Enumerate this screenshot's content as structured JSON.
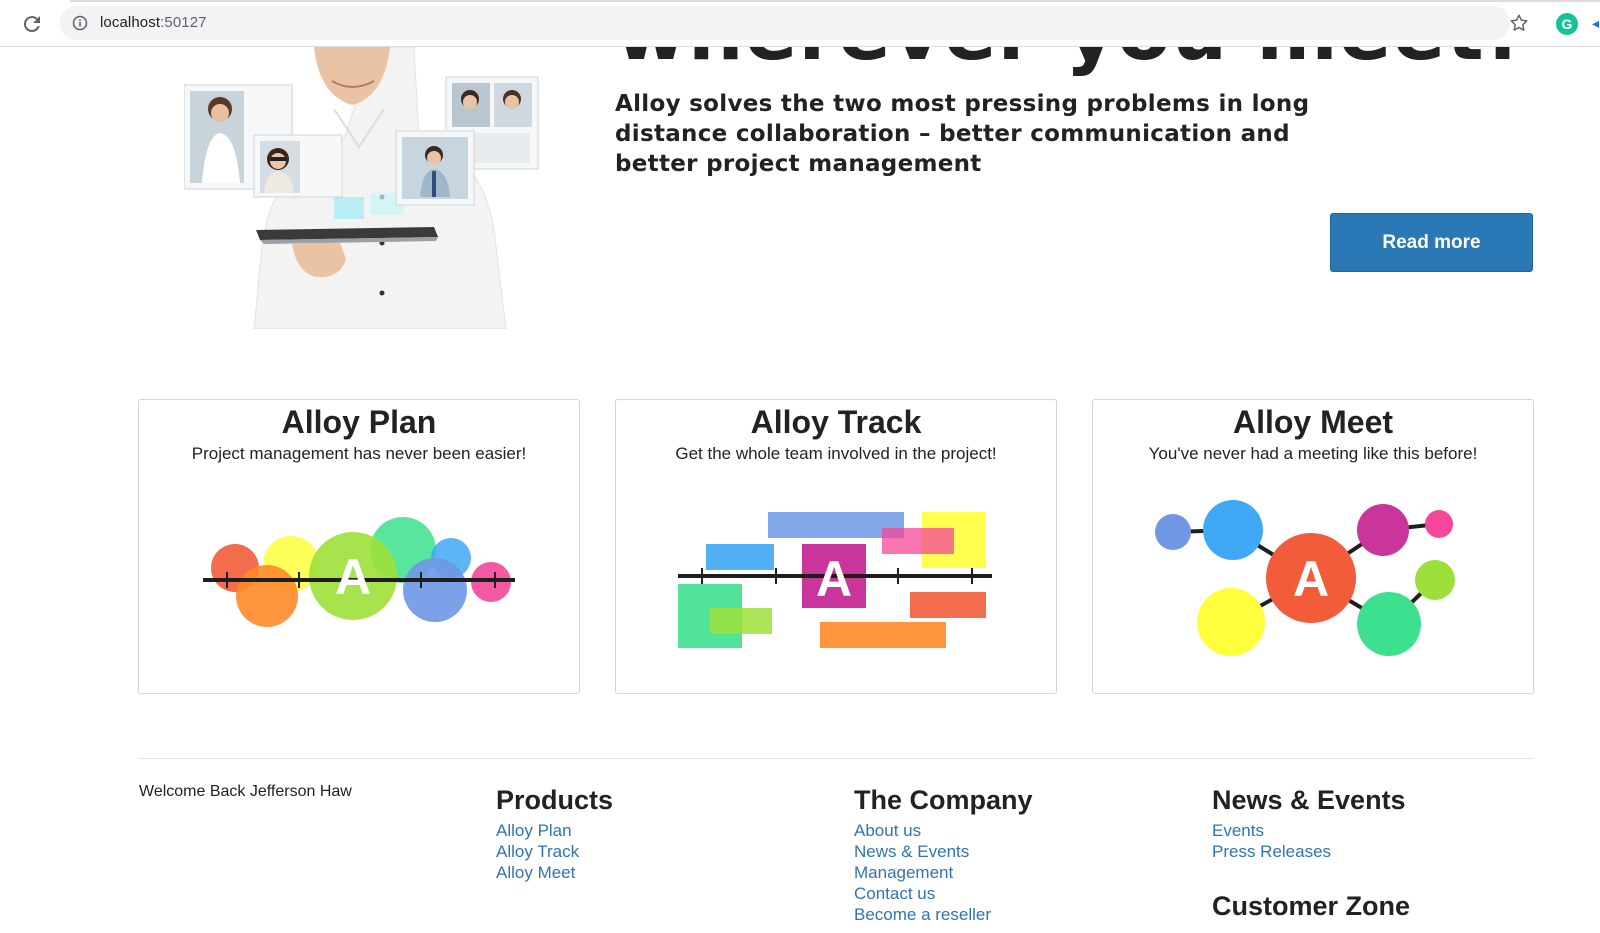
{
  "browser": {
    "url_host": "localhost",
    "url_port": ":50127",
    "extension_letter": "G"
  },
  "hero": {
    "heading": "wherever you meet!",
    "subheading": "Alloy solves the two most pressing problems in long distance collaboration – better communication and better project management",
    "read_more_label": "Read more"
  },
  "products": [
    {
      "title": "Alloy Plan",
      "description": "Project management has never been easier!",
      "icon": "alloy-plan-logo"
    },
    {
      "title": "Alloy Track",
      "description": "Get the whole team involved in the project!",
      "icon": "alloy-track-logo"
    },
    {
      "title": "Alloy Meet",
      "description": "You've never had a meeting like this before!",
      "icon": "alloy-meet-logo"
    }
  ],
  "logo_letter": "A",
  "footer": {
    "welcome": "Welcome Back Jefferson Haw",
    "columns": [
      {
        "heading": "Products",
        "links": [
          "Alloy Plan",
          "Alloy Track",
          "Alloy Meet"
        ]
      },
      {
        "heading": "The Company",
        "links": [
          "About us",
          "News & Events",
          "Management",
          "Contact us",
          "Become a reseller"
        ]
      },
      {
        "heading": "News & Events",
        "links": [
          "Events",
          "Press Releases"
        ]
      }
    ],
    "customer_zone_heading": "Customer Zone"
  },
  "colors": {
    "button": "#2a78b5",
    "link": "#2f74b5"
  }
}
